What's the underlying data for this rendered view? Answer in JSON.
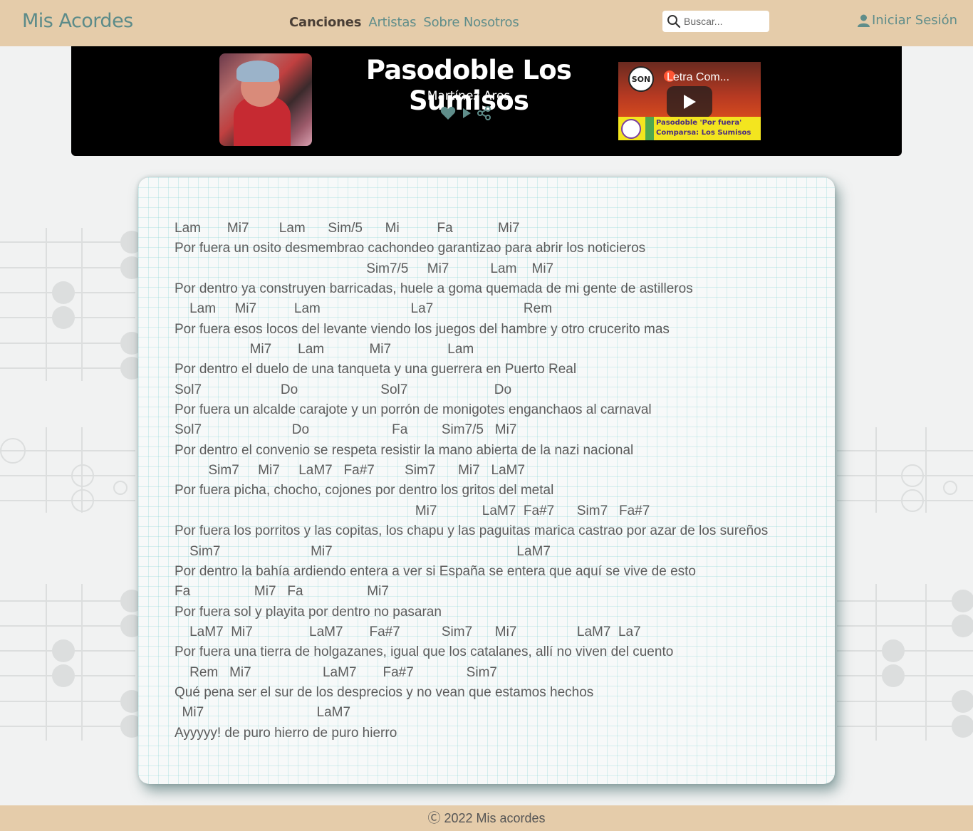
{
  "navbar": {
    "brand": "Mis Acordes",
    "links": [
      {
        "label": "Canciones",
        "active": true
      },
      {
        "label": "Artistas",
        "active": false
      },
      {
        "label": "Sobre Nosotros",
        "active": false
      }
    ],
    "search_placeholder": "Buscar...",
    "search_icon": "search-icon",
    "login_label": "Iniciar Sesión",
    "login_icon": "user-icon"
  },
  "song": {
    "title": "Pasodoble Los Sumisos",
    "artist": "Martínez Ares",
    "actions": [
      "heart-icon",
      "play-icon",
      "share-icon"
    ],
    "video": {
      "channel_logo": "SON",
      "title": "Letra Com...",
      "banner_line1": "Pasodoble 'Por fuera'",
      "banner_line2": "Comparsa: Los Sumisos"
    }
  },
  "lyrics": [
    "Lam       Mi7        Lam      Sim/5      Mi          Fa            Mi7",
    "Por fuera un osito desmembrao cachondeo garantizao para abrir los noticieros",
    "                                                   Sim7/5     Mi7           Lam    Mi7",
    "Por dentro ya construyen barricadas, huele a goma quemada de mi gente de astilleros",
    "    Lam     Mi7          Lam                        La7                        Rem",
    "Por fuera esos locos del levante viendo los juegos del hambre y otro crucerito mas",
    "                    Mi7       Lam            Mi7               Lam",
    "Por dentro el duelo de una tanqueta y una guerrera en Puerto Real",
    "Sol7                     Do                      Sol7                       Do",
    "Por fuera un alcalde carajote y un porrón de monigotes enganchaos al carnaval",
    "Sol7                        Do                      Fa         Sim7/5   Mi7",
    "Por dentro el convenio se respeta resistir la mano abierta de la nazi nacional",
    "         Sim7     Mi7     LaM7   Fa#7        Sim7      Mi7   LaM7",
    "Por fuera picha, chocho, cojones por dentro los gritos del metal",
    "                                                                Mi7            LaM7  Fa#7      Sim7   Fa#7",
    "Por fuera los porritos y las copitas, los chapu y las paguitas marica castrao por azar de los sureños",
    "    Sim7                        Mi7                                                 LaM7",
    "Por dentro la bahía ardiendo entera a ver si España se entera que aquí se vive de esto",
    "Fa                 Mi7   Fa                 Mi7",
    "Por fuera sol y playita por dentro no pasaran",
    "    LaM7  Mi7               LaM7       Fa#7           Sim7      Mi7                LaM7  La7",
    "Por fuera una tierra de holgazanes, igual que los catalanes, allí no viven del cuento",
    "    Rem   Mi7                   LaM7       Fa#7              Sim7",
    "Qué pena ser el sur de los desprecios y no vean que estamos hechos",
    "  Mi7                              LaM7",
    "Ayyyyy! de puro hierro de puro hierro"
  ],
  "footer": {
    "text": "Ⓒ 2022 Mis acordes"
  },
  "colors": {
    "navbar_bg": "#e5ccaa",
    "brand": "#5c8b89",
    "banner_bg": "#000000",
    "lyrics_text": "#5c5c5c"
  }
}
